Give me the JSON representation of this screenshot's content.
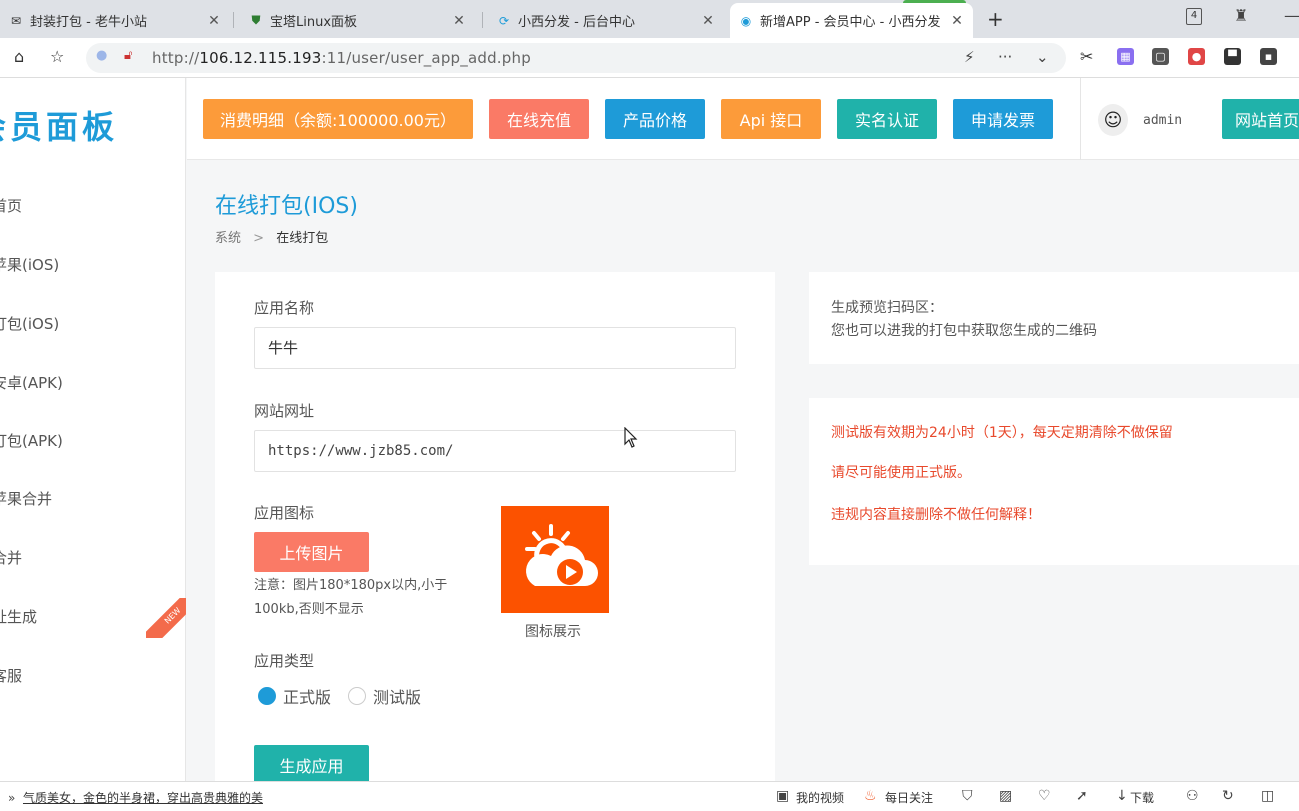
{
  "browser": {
    "tabs": [
      {
        "title": "封装打包 - 老牛小站",
        "close": "✕"
      },
      {
        "title": "宝塔Linux面板",
        "close": "✕"
      },
      {
        "title": "小西分发 - 后台中心",
        "close": "✕"
      },
      {
        "title": "新增APP - 会员中心 - 小西分发",
        "close": "✕"
      }
    ],
    "new_tab": "+",
    "tab_count": "4",
    "url_prefix": "http://",
    "url_host": "106.12.115.193",
    "url_rest": ":11/user/user_app_add.php"
  },
  "sidebar": {
    "logo": "会员面板",
    "items": [
      {
        "label": "首页"
      },
      {
        "label": "苹果(iOS)"
      },
      {
        "label": "打包(iOS)"
      },
      {
        "label": "安卓(APK)"
      },
      {
        "label": "打包(APK)"
      },
      {
        "label": "苹果合并"
      },
      {
        "label": "合并"
      },
      {
        "label": "址生成"
      },
      {
        "label": "客服"
      }
    ],
    "new_badge": "NEW"
  },
  "topbar": {
    "buttons": [
      {
        "label": "消费明细（余额:100000.00元）",
        "color": "#fc9b3a"
      },
      {
        "label": "在线充值",
        "color": "#fa7a66"
      },
      {
        "label": "产品价格",
        "color": "#1e9bd8"
      },
      {
        "label": "Api 接口",
        "color": "#fc9b3a"
      },
      {
        "label": "实名认证",
        "color": "#20b2aa"
      },
      {
        "label": "申请发票",
        "color": "#1e9bd8"
      }
    ],
    "user": "admin",
    "home_button": "网站首页"
  },
  "page": {
    "title": "在线打包(IOS)",
    "breadcrumb": {
      "root": "系统",
      "separator": ">",
      "current": "在线打包"
    }
  },
  "form": {
    "app_name_label": "应用名称",
    "app_name_value": "牛牛",
    "site_url_label": "网站网址",
    "site_url_value": "https://www.jzb85.com/",
    "icon_label": "应用图标",
    "upload_button": "上传图片",
    "upload_note": "注意：图片180*180px以内,小于100kb,否则不显示",
    "icon_caption": "图标展示",
    "app_type_label": "应用类型",
    "app_types": [
      {
        "label": "正式版",
        "selected": true
      },
      {
        "label": "测试版",
        "selected": false
      }
    ],
    "generate_button": "生成应用",
    "apple_glyph": ""
  },
  "preview": {
    "line1": "生成预览扫码区：",
    "line2": "您也可以进我的打包中获取您生成的二维码"
  },
  "warnings": [
    "测试版有效期为24小时（1天），每天定期清除不做保留",
    "请尽可能使用正式版。",
    "违规内容直接删除不做任何解释！"
  ],
  "colors": {
    "accent_blue": "#1e9bd8",
    "orange": "#fc9b3a",
    "salmon": "#fa7a66",
    "teal": "#20b2aa",
    "warn_red": "#e8492c",
    "icon_bg": "#fc5200"
  },
  "statusbar": {
    "ad_text": "气质美女，金色的半身裙，穿出高贵典雅的美",
    "my_video": "我的视频",
    "daily_follow": "每日关注",
    "download": "下载"
  }
}
